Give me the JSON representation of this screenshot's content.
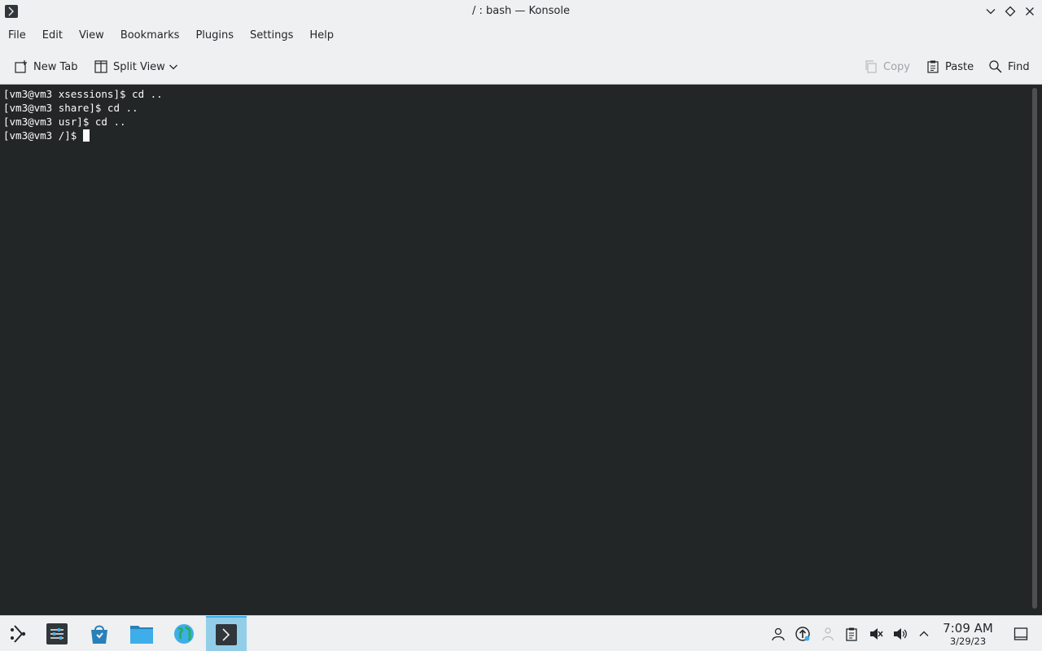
{
  "window": {
    "title": "/ : bash — Konsole"
  },
  "menu": {
    "items": [
      "File",
      "Edit",
      "View",
      "Bookmarks",
      "Plugins",
      "Settings",
      "Help"
    ]
  },
  "toolbar": {
    "new_tab": "New Tab",
    "split_view": "Split View",
    "copy": "Copy",
    "paste": "Paste",
    "find": "Find"
  },
  "terminal": {
    "lines": [
      "[vm3@vm3 xsessions]$ cd ..",
      "[vm3@vm3 share]$ cd ..",
      "[vm3@vm3 usr]$ cd ..",
      "[vm3@vm3 /]$ "
    ],
    "background": "#232627",
    "foreground": "#fcfcfc"
  },
  "taskbar": {
    "apps": [
      "application-launcher-icon",
      "system-settings-icon",
      "discover-icon",
      "dolphin-folder-icon",
      "web-browser-icon",
      "konsole-icon"
    ],
    "tray": [
      "user-icon",
      "update-icon",
      "network-icon",
      "clipboard-icon",
      "notifications-muted-icon",
      "volume-icon",
      "expand-tray-icon"
    ],
    "clock_time": "7:09 AM",
    "clock_date": "3/29/23",
    "accent": "#3daee9"
  }
}
